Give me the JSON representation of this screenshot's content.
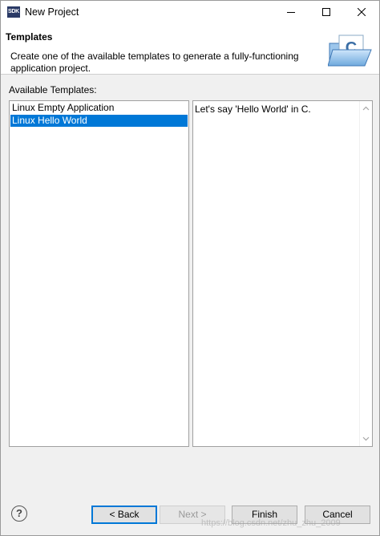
{
  "window": {
    "title": "New Project",
    "app_icon_text": "SDK"
  },
  "header": {
    "title": "Templates",
    "description": "Create one of the available templates to generate a fully-functioning application project.",
    "icon": "c-project-folder-icon"
  },
  "templates": {
    "label": "Available Templates:",
    "items": [
      {
        "label": "Linux Empty Application",
        "selected": false
      },
      {
        "label": "Linux Hello World",
        "selected": true
      }
    ],
    "description": "Let's say 'Hello World' in C."
  },
  "buttons": {
    "back": "< Back",
    "next": "Next >",
    "finish": "Finish",
    "cancel": "Cancel"
  },
  "watermark": "https://blog.csdn.net/zhu_zhu_2009",
  "colors": {
    "selection": "#0078d7",
    "dialog_bg": "#f0f0f0"
  }
}
